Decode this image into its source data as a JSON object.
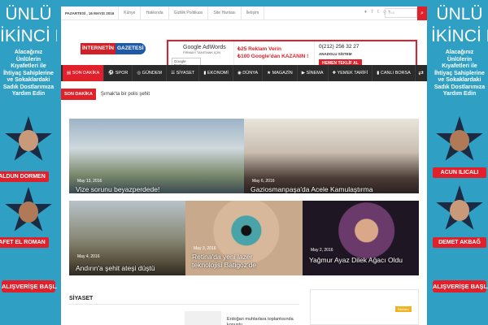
{
  "left_banner": {
    "title_line1": "ÜNLÜ",
    "title_line2": "İKİNCİ EL",
    "subtitle": "Alacağınız Ünlülerin Kıyafetleri ile İhtiyaç Sahiplerine ve Sokaklardaki Sadık Dostlarımıza Yardım Edin",
    "celeb1": "ALDUN DORMEN",
    "celeb2": "AFET EL ROMAN",
    "shop_button": "ALIŞVERİŞE BAŞLA"
  },
  "right_banner": {
    "title_line1": "ÜNLÜ",
    "title_line2": "İKİNCİ EL",
    "subtitle": "Alacağınız Ünlülerin Kıyafetleri ile İhtiyaç Sahiplerine ve Sokaklardaki Sadık Dostlarımıza Yardım Edin",
    "celeb1": "ACUN ILICALI",
    "celeb2": "DEMET AKBAĞ",
    "shop_button": "ALIŞVERİŞE BAŞLA"
  },
  "topbar": {
    "date": "PAZARTESİ , 16 MAYIS 2016",
    "links": [
      "Künye",
      "Hakkında",
      "Gizlilik Politikası",
      "Site Haritası",
      "İletişim"
    ],
    "social_icons": [
      "rss-icon",
      "facebook-icon",
      "twitter-icon",
      "google-plus-icon"
    ],
    "social_text": "♦ f t g+",
    "search_placeholder": "Ara",
    "search_icon": "search-icon"
  },
  "logo": {
    "part1": "İNTERNETİN",
    "part2": "GAZETESİ"
  },
  "ad": {
    "google_title": "Google AdWords",
    "google_sub": "FİRMAYI TANITMAK İÇİN",
    "partner": "Google Partner",
    "line1": "₺25 Reklam Verin",
    "line2": "₺100 Google'dan KAZANIN !",
    "phone": "0(212) 256 32 27",
    "firm": "ANADOLU SİSTEM",
    "button": "HEMEN TEKLİF AL"
  },
  "nav": {
    "items": [
      "SON DAKİKA",
      "SPOR",
      "GÜNDEM",
      "SİYASET",
      "EKONOMİ",
      "DÜNYA",
      "MAGAZİN",
      "SİNEMA",
      "YEMEK TARİFİ",
      "CANLI BORSA"
    ],
    "icons": [
      "news-icon",
      "soccer-icon",
      "globe-icon",
      "list-icon",
      "chart-icon",
      "world-icon",
      "star-icon",
      "film-icon",
      "food-icon",
      "chart-icon"
    ]
  },
  "breaking": {
    "label": "SON DAKİKA",
    "text": "Şırnak'ta bir polis şehit"
  },
  "news": [
    {
      "date": "May 13, 2016",
      "title": "Vize sorunu beyazperdede!"
    },
    {
      "date": "May 6, 2016",
      "title": "Gaziosmanpaşa'da Acele Kamulaştırma"
    },
    {
      "date": "May 4, 2016",
      "title": "Andırın'a şehit ateşi düştü"
    },
    {
      "date": "May 3, 2016",
      "title": "Retina'da yeni lazer teknolojisi Batigöz'de"
    },
    {
      "date": "May 2, 2016",
      "title": "Yağmur Ayaz Dilek Ağacı Oldu"
    }
  ],
  "section": {
    "title": "SİYASET",
    "snippet": "Erdoğan muhtarlara toplantısında konuştu"
  },
  "sidebox": {
    "tag": "Reklam"
  },
  "colors": {
    "background": "#2f9fc4",
    "accent": "#e0202a",
    "nav": "#2b2b2b"
  }
}
